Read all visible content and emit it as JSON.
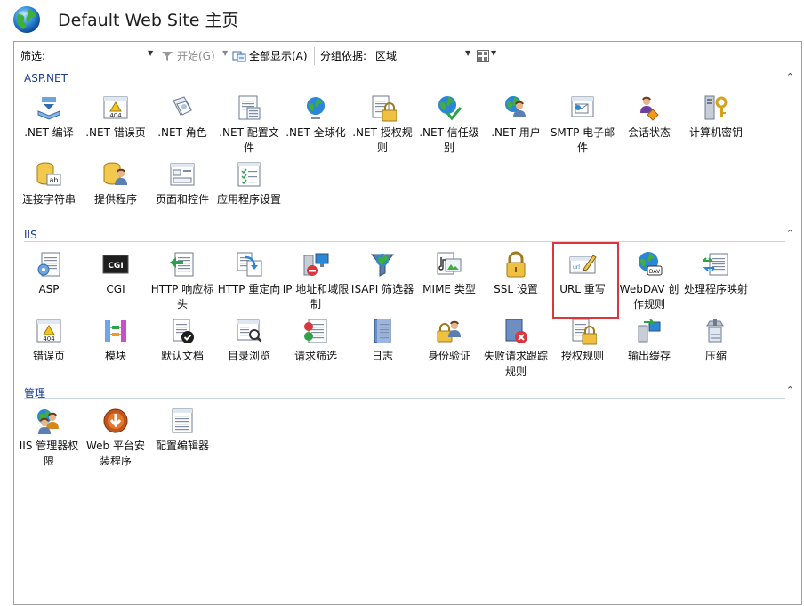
{
  "window": {
    "title": "Default Web Site 主页"
  },
  "toolbar": {
    "filter_label": "筛选:",
    "filter_value": "",
    "start_label": "开始(G)",
    "show_all_label": "全部显示(A)",
    "group_by_label": "分组依据:",
    "group_by_value": "区域"
  },
  "sections": [
    {
      "title": "ASP.NET",
      "items": [
        {
          "label": ".NET 编译",
          "icon": "compile-icon"
        },
        {
          "label": ".NET 错误页",
          "icon": "error-404-icon"
        },
        {
          "label": ".NET 角色",
          "icon": "roles-icon"
        },
        {
          "label": ".NET 配置文件",
          "icon": "profile-icon"
        },
        {
          "label": ".NET 全球化",
          "icon": "globe-icon"
        },
        {
          "label": ".NET 授权规则",
          "icon": "auth-rules-icon"
        },
        {
          "label": ".NET 信任级别",
          "icon": "trust-level-icon"
        },
        {
          "label": ".NET 用户",
          "icon": "users-icon"
        },
        {
          "label": "SMTP 电子邮件",
          "icon": "email-icon"
        },
        {
          "label": "会话状态",
          "icon": "session-icon"
        },
        {
          "label": "计算机密钥",
          "icon": "machine-key-icon"
        },
        {
          "label": "连接字符串",
          "icon": "connection-string-icon"
        },
        {
          "label": "提供程序",
          "icon": "providers-icon"
        },
        {
          "label": "页面和控件",
          "icon": "pages-controls-icon"
        },
        {
          "label": "应用程序设置",
          "icon": "app-settings-icon"
        }
      ]
    },
    {
      "title": "IIS",
      "items": [
        {
          "label": "ASP",
          "icon": "asp-icon"
        },
        {
          "label": "CGI",
          "icon": "cgi-icon"
        },
        {
          "label": "HTTP 响应标头",
          "icon": "http-headers-icon"
        },
        {
          "label": "HTTP 重定向",
          "icon": "redirect-icon"
        },
        {
          "label": "IP 地址和域限制",
          "icon": "ip-restriction-icon"
        },
        {
          "label": "ISAPI 筛选器",
          "icon": "isapi-filter-icon"
        },
        {
          "label": "MIME 类型",
          "icon": "mime-icon"
        },
        {
          "label": "SSL 设置",
          "icon": "lock-icon"
        },
        {
          "label": "URL 重写",
          "icon": "url-rewrite-icon"
        },
        {
          "label": "WebDAV 创作规则",
          "icon": "webdav-icon"
        },
        {
          "label": "处理程序映射",
          "icon": "handler-mappings-icon"
        },
        {
          "label": "错误页",
          "icon": "error-404-icon"
        },
        {
          "label": "模块",
          "icon": "modules-icon"
        },
        {
          "label": "默认文档",
          "icon": "default-document-icon"
        },
        {
          "label": "目录浏览",
          "icon": "directory-browsing-icon"
        },
        {
          "label": "请求筛选",
          "icon": "request-filtering-icon"
        },
        {
          "label": "日志",
          "icon": "logging-icon"
        },
        {
          "label": "身份验证",
          "icon": "authentication-icon"
        },
        {
          "label": "失败请求跟踪规则",
          "icon": "failed-request-icon"
        },
        {
          "label": "授权规则",
          "icon": "auth-rules-icon"
        },
        {
          "label": "输出缓存",
          "icon": "output-cache-icon"
        },
        {
          "label": "压缩",
          "icon": "compression-icon"
        }
      ]
    },
    {
      "title": "管理",
      "items": [
        {
          "label": "IIS 管理器权限",
          "icon": "manager-permissions-icon"
        },
        {
          "label": "Web 平台安装程序",
          "icon": "web-platform-icon"
        },
        {
          "label": "配置编辑器",
          "icon": "config-editor-icon"
        }
      ]
    }
  ]
}
